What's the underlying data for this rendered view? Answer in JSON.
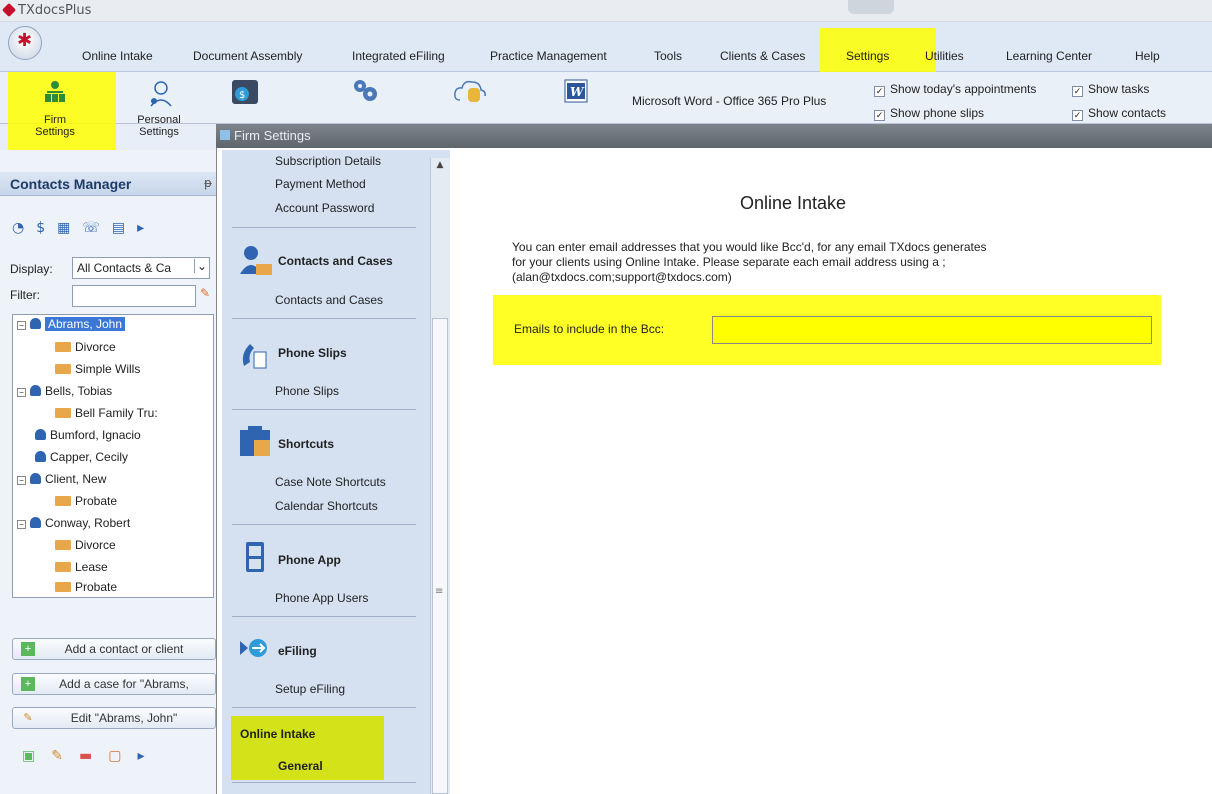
{
  "window": {
    "title": "TXdocsPlus"
  },
  "menu": [
    "Online Intake",
    "Document Assembly",
    "Integrated eFiling",
    "Practice Management",
    "Tools",
    "Clients & Cases",
    "Settings",
    "Utilities",
    "Learning Center",
    "Help"
  ],
  "ribbon": {
    "firm_settings": "Firm Settings",
    "personal_settings": "Personal Settings",
    "office_label": "Microsoft Word - Office 365 Pro Plus",
    "checks": {
      "appointments": "Show today's appointments",
      "tasks": "Show tasks",
      "phone_slips": "Show phone slips",
      "contacts": "Show contacts"
    }
  },
  "contacts_manager": {
    "title": "Contacts Manager",
    "display_label": "Display:",
    "display_value": "All Contacts & Ca",
    "filter_label": "Filter:",
    "tree": [
      {
        "name": "Abrams, John",
        "selected": true,
        "cases": [
          "Divorce",
          "Simple Wills"
        ]
      },
      {
        "name": "Bells, Tobias",
        "cases": [
          "Bell Family Tru:"
        ]
      },
      {
        "name": "Bumford, Ignacio",
        "cases": []
      },
      {
        "name": "Capper, Cecily",
        "cases": []
      },
      {
        "name": "Client, New",
        "cases": [
          "Probate"
        ]
      },
      {
        "name": "Conway, Robert",
        "cases": [
          "Divorce",
          "Lease",
          "Probate"
        ]
      }
    ],
    "actions": {
      "add_contact": "Add a contact or client",
      "add_case": "Add a case for \"Abrams,",
      "edit": "Edit \"Abrams, John\""
    }
  },
  "firm_settings": {
    "title": "Firm Settings",
    "nav": {
      "subscription_details": "Subscription Details",
      "payment_method": "Payment Method",
      "account_password": "Account Password",
      "contacts_header": "Contacts and Cases",
      "contacts_item": "Contacts and Cases",
      "phone_slips_header": "Phone Slips",
      "phone_slips_item": "Phone Slips",
      "shortcuts_header": "Shortcuts",
      "case_note_shortcuts": "Case Note Shortcuts",
      "calendar_shortcuts": "Calendar Shortcuts",
      "phone_app_header": "Phone App",
      "phone_app_users": "Phone App Users",
      "efiling_header": "eFiling",
      "setup_efiling": "Setup eFiling",
      "online_intake_header": "Online Intake",
      "general": "General"
    },
    "content": {
      "heading": "Online Intake",
      "description_1": "You can enter email addresses that you would like Bcc'd, for any email TXdocs generates",
      "description_2": "for your clients using Online Intake. Please separate each email address using a ;",
      "description_3": "(alan@txdocs.com;support@txdocs.com)",
      "bcc_label": "Emails to include in the Bcc:",
      "bcc_value": ""
    }
  },
  "colors": {
    "highlight": "#ffff00",
    "accent": "#2f64b0"
  }
}
